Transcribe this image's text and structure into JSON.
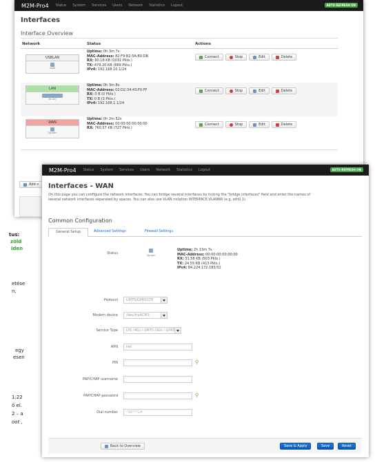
{
  "colors": {
    "navbar": "#1b1b1b",
    "autorefresh": "#46a546",
    "lan_green": "#a9e4a2",
    "wan_red": "#f0a3a3",
    "save_blue": "#1166c5"
  },
  "back": {
    "brand": "M2M-Pro4",
    "menu": [
      "Status",
      "System",
      "Services",
      "Users",
      "Network",
      "Statistics",
      "Logout"
    ],
    "autorefresh": "AUTO REFRESH ON",
    "title": "Interfaces",
    "subtitle": "Interface Overview",
    "col_network": "Network",
    "col_status": "Status",
    "col_actions": "Actions",
    "add_label": "Add n",
    "rows": [
      {
        "name": "USBLAN",
        "sub": "usb0",
        "status": [
          {
            "k": "Uptime:",
            "v": " 0h 3m 7s"
          },
          {
            "k": "MAC-Address:",
            "v": " 82:F9:B2:5A:B0:DB"
          },
          {
            "k": "RX:",
            "v": " 90.18 KB (1031 Pkts.)"
          },
          {
            "k": "TX:",
            "v": " 479.20 KB (889 Pkts.)"
          },
          {
            "k": "IPv4:",
            "v": " 192.168.10.1/24"
          }
        ]
      },
      {
        "name": "LAN",
        "sub": "br-lan",
        "status": [
          {
            "k": "Uptime:",
            "v": " 0h 3m 8s"
          },
          {
            "k": "MAC-Address:",
            "v": " 02:D2:34:43:F0:FF"
          },
          {
            "k": "RX:",
            "v": " 0 B (0 Pkts.)"
          },
          {
            "k": "TX:",
            "v": " 0 B (3 Pkts.)"
          },
          {
            "k": "IPv4:",
            "v": " 192.168.1.1/24"
          }
        ]
      },
      {
        "name": "WAN",
        "sub": "3g-wan",
        "status": [
          {
            "k": "Uptime:",
            "v": " 0h 2m 52s"
          },
          {
            "k": "MAC-Address:",
            "v": " 00:00:00:00:00:00"
          },
          {
            "k": "RX:",
            "v": " 760.57 KB (727 Pkts.)"
          }
        ]
      }
    ],
    "actions": {
      "connect": "Connect",
      "stop": "Stop",
      "edit": "Edit",
      "delete": "Delete"
    }
  },
  "front": {
    "brand": "M2M-Pro4",
    "menu": [
      "Status",
      "System",
      "Services",
      "Users",
      "Network",
      "Statistics",
      "Logout"
    ],
    "autorefresh": "AUTO REFRESH ON",
    "title": "Interfaces - WAN",
    "description_1": "On this page you can configure the network interfaces. You can bridge several interfaces by ticking the \"bridge interfaces\" field and enter the names of",
    "description_2": "several network interfaces separated by spaces. You can also use VLAN notation INTERFACE.VLANNR (e.g. eth0.1).",
    "section": "Common Configuration",
    "tabs": [
      "General Setup",
      "Advanced Settings",
      "Firewall Settings"
    ],
    "status_label": "Status",
    "status_iface": "3g-wan",
    "status": [
      {
        "k": "Uptime:",
        "v": " 2h 13m 7s"
      },
      {
        "k": "MAC-Address:",
        "v": " 00:00:00:00:00:00"
      },
      {
        "k": "RX:",
        "v": " 31.58 KB (503 Pkts.)"
      },
      {
        "k": "TX:",
        "v": " 24.55 KB (413 Pkts.)"
      },
      {
        "k": "IPv4:",
        "v": " 84.224.172.183/32"
      }
    ],
    "fields": {
      "protocol_label": "Protocol",
      "protocol_value": "UMTS/GPRS/LTE",
      "modem_label": "Modem device",
      "modem_value": "/dev/ttyACM3",
      "service_label": "Service Type",
      "service_value": "LTE (4G) / UMTS (3G) / GPRS (",
      "apn_label": "APN",
      "apn_value": "net",
      "pin_label": "PIN",
      "pap_user_label": "PAP/CHAP username",
      "pap_pass_label": "PAP/CHAP password",
      "dial_label": "Dial number",
      "dial_value": "*99***1#"
    },
    "back_button": "Back to Overview",
    "save_apply": "Save & Apply",
    "save": "Save",
    "reset": "Reset"
  },
  "side": {
    "t1": "tus:",
    "t2": "zöld",
    "t3": "iden",
    "t4": "etése",
    "t5": "n.",
    "t6": "egy",
    "t7": "esen",
    "t8": "1:22",
    "t9": "ő el.",
    "t10": "2 – a",
    "t11": "oot ,"
  }
}
